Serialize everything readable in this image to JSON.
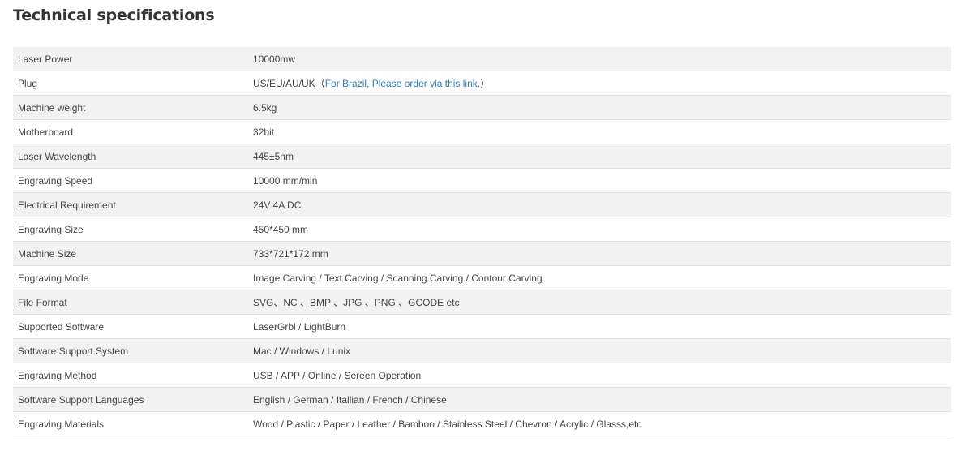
{
  "title": "Technical specifications",
  "specs": [
    {
      "label": "Laser Power",
      "value": "10000mw"
    },
    {
      "label": "Plug",
      "value": "US/EU/AU/UK",
      "paren_open": "（",
      "link_text": "For Brazil, Please order via this link.",
      "paren_close": "）"
    },
    {
      "label": "Machine weight",
      "value": "6.5kg"
    },
    {
      "label": "Motherboard",
      "value": "32bit"
    },
    {
      "label": "Laser Wavelength",
      "value": "445±5nm"
    },
    {
      "label": "Engraving Speed",
      "value": "10000 mm/min"
    },
    {
      "label": "Electrical Requirement",
      "value": "24V 4A DC"
    },
    {
      "label": "Engraving Size",
      "value": "450*450 mm"
    },
    {
      "label": "Machine Size",
      "value": "733*721*172 mm"
    },
    {
      "label": "Engraving Mode",
      "value": "Image Carving / Text Carving / Scanning Carving / Contour Carving"
    },
    {
      "label": "File Format",
      "value": "SVG、NC 、BMP 、JPG 、PNG 、GCODE etc"
    },
    {
      "label": "Supported Software",
      "value": "LaserGrbl / LightBurn"
    },
    {
      "label": "Software Support System",
      "value": "Mac / Windows / Lunix"
    },
    {
      "label": "Engraving Method",
      "value": "USB / APP / Online / Sereen Operation"
    },
    {
      "label": "Software Support Languages",
      "value": "English / German / Itallian / French / Chinese"
    },
    {
      "label": "Engraving Materials",
      "value": "Wood / Plastic / Paper / Leather / Bamboo / Stainless Steel / Chevron /  Acrylic / Glasss,etc"
    }
  ],
  "colors": {
    "link": "#2f7ec1",
    "row_stripe": "#f2f2f2",
    "text": "#444444",
    "title": "#333333"
  }
}
